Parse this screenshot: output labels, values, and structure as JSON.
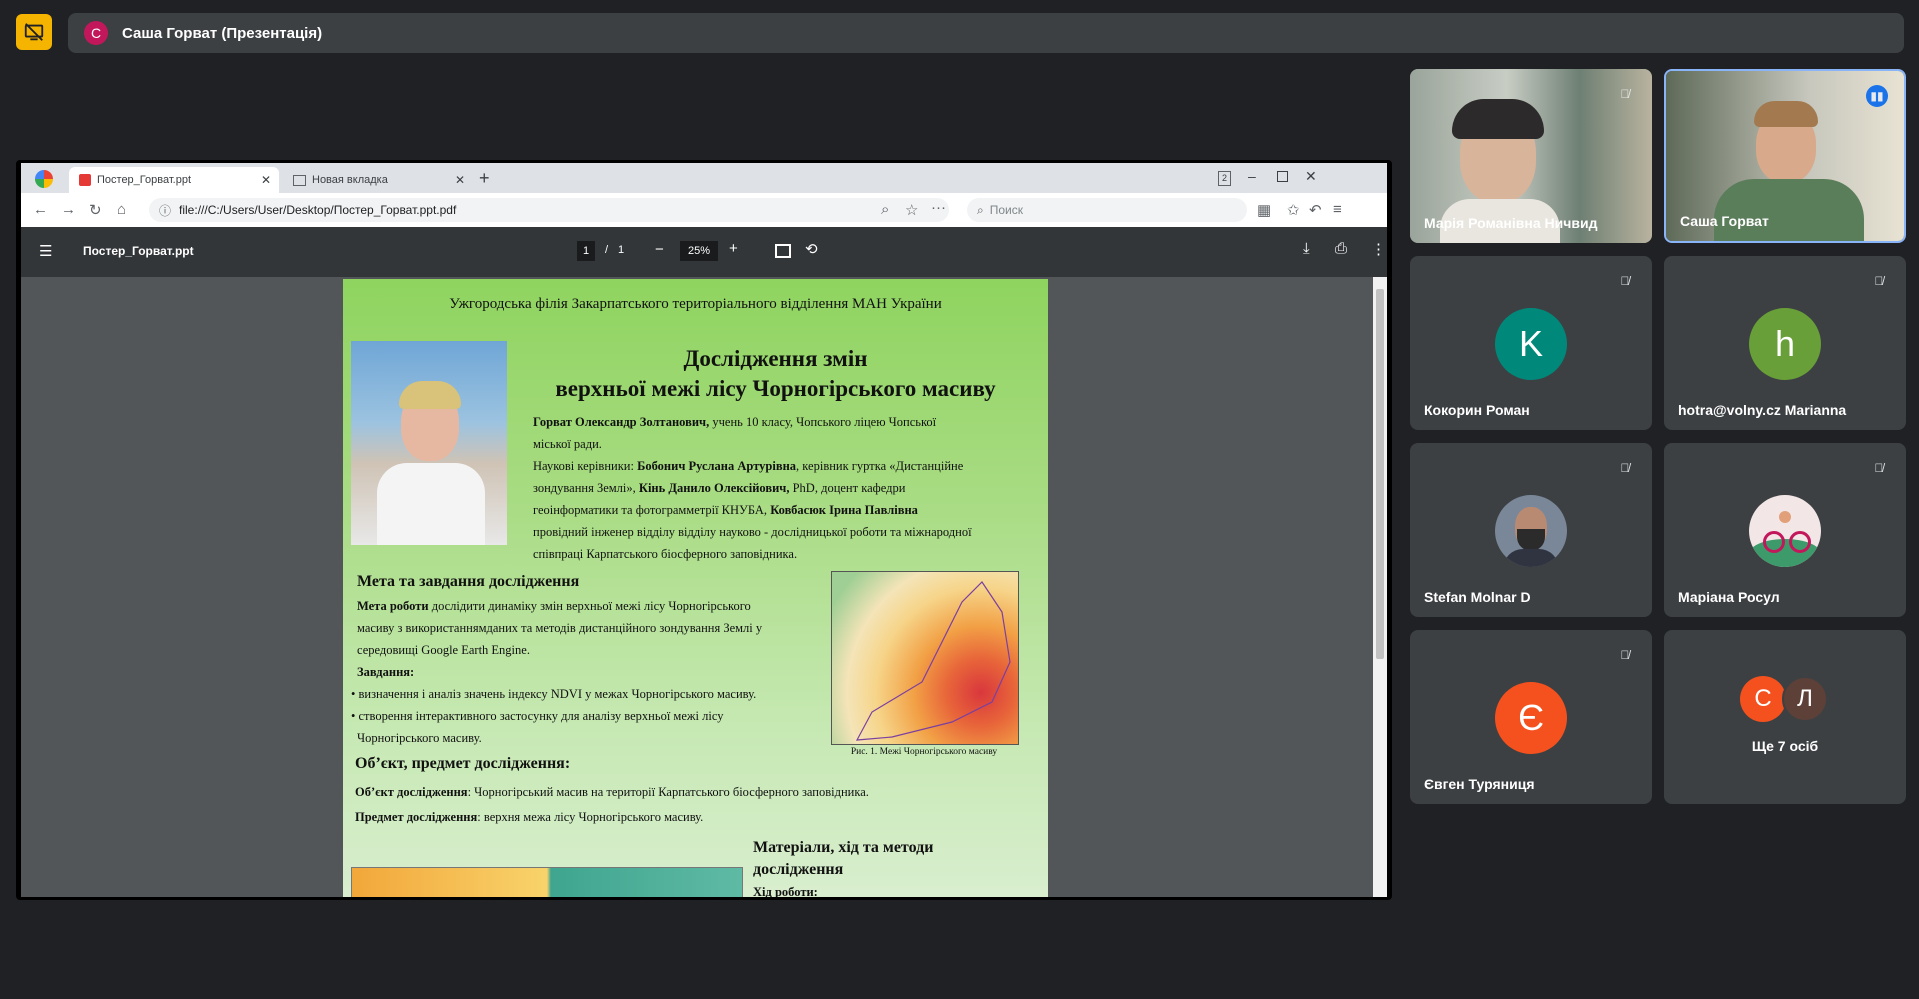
{
  "presenter_bar": {
    "avatar_letter": "С",
    "title": "Саша Горват (Презентація)"
  },
  "browser": {
    "tabs": [
      {
        "label": "Постер_Горват.ppt"
      },
      {
        "label": "Новая вкладка"
      }
    ],
    "tab_count_badge": "2",
    "url": "file:///C:/Users/User/Desktop/Постер_Горват.ppt.pdf",
    "search_placeholder": "Поиск"
  },
  "pdf_viewer": {
    "file_name": "Постер_Горват.ppt",
    "current_page": "1",
    "page_sep": "/",
    "total_pages": "1",
    "zoom": "25%"
  },
  "poster": {
    "header": "Ужгородська філія Закарпатського територіального відділення МАН України",
    "title_line1": "Дослідження змін",
    "title_line2": "верхньої межі лісу Чорногірського масиву",
    "author_bold": "Горват Олександр Золтанович,",
    "author_rest": " учень 10 класу, Чопського ліцею Чопської",
    "author_line2": "міської ради.",
    "advisors_prefix": "Наукові керівники: ",
    "advisor1_bold": "Бобонич Руслана Артурівна",
    "advisor1_rest": ", керівник гуртка «Дистанційне",
    "advisor_line2_start": "зондування Землі», ",
    "advisor2_bold": "Кінь Данило Олексійович,",
    "advisor2_rest": " PhD, доцент кафедри",
    "advisor_line3_start": "геоінформатики та фотограмметрії КНУБА, ",
    "advisor3_bold": "Ковбасюк Ірина Павлівна",
    "advisor_line4": "провідний інженер відділу відділу науково - дослідницької роботи та міжнародної",
    "advisor_line5": "співпраці Карпатського біосферного заповідника.",
    "goal_heading": "Мета та завдання дослідження",
    "goal_bold": "Мета роботи",
    "goal_rest": " дослідити динаміку змін верхньої межі лісу Чорногірського",
    "goal_line2": "масиву з використаннямданих та методів дистанційного зондування Землі у",
    "goal_line3": "середовищі Google Earth Engine.",
    "tasks_heading": "Завдання:",
    "task1": "• визначення і аналіз значень індексу NDVI у межах Чорногірського масиву.",
    "task2": "• створення інтерактивного застосунку для аналізу верхньої межі лісу",
    "task2_line2": "Чорногірського масиву.",
    "figure_caption": "Рис. 1. Межі Чорногірського масиву",
    "object_heading": "Об’єкт, предмет дослідження:",
    "object_bold": "Об’єкт дослідження",
    "object_rest": ": Чорногірський масив на території Карпатського біосферного заповідника.",
    "subject_bold": "Предмет дослідження",
    "subject_rest": ": верхня межа лісу Чорногірського масиву.",
    "methods_heading_line1": "Матеріали, хід та методи",
    "methods_heading_line2": "дослідження",
    "methods_sub": "Хід роботи:"
  },
  "participants": [
    {
      "name": "Марія Романівна Ничвид",
      "type": "video",
      "muted": true
    },
    {
      "name": "Саша Горват",
      "type": "video",
      "speaking": true
    },
    {
      "name": "Кокорин Роман",
      "letter": "K",
      "color": "#00897b",
      "muted": true
    },
    {
      "name": "hotra@volny.cz Marianna",
      "letter": "h",
      "color": "#689f38",
      "muted": true
    },
    {
      "name": "Stefan Molnar D",
      "type": "photo",
      "muted": true
    },
    {
      "name": "Маріана Росул",
      "type": "photo",
      "muted": true
    },
    {
      "name": "Євген Туряниця",
      "letter": "Є",
      "color": "#f4511e",
      "muted": true
    }
  ],
  "more": {
    "letters": [
      "С",
      "Л"
    ],
    "colors": [
      "#f4511e",
      "#5d4037"
    ],
    "label": "Ще 7 осіб"
  }
}
